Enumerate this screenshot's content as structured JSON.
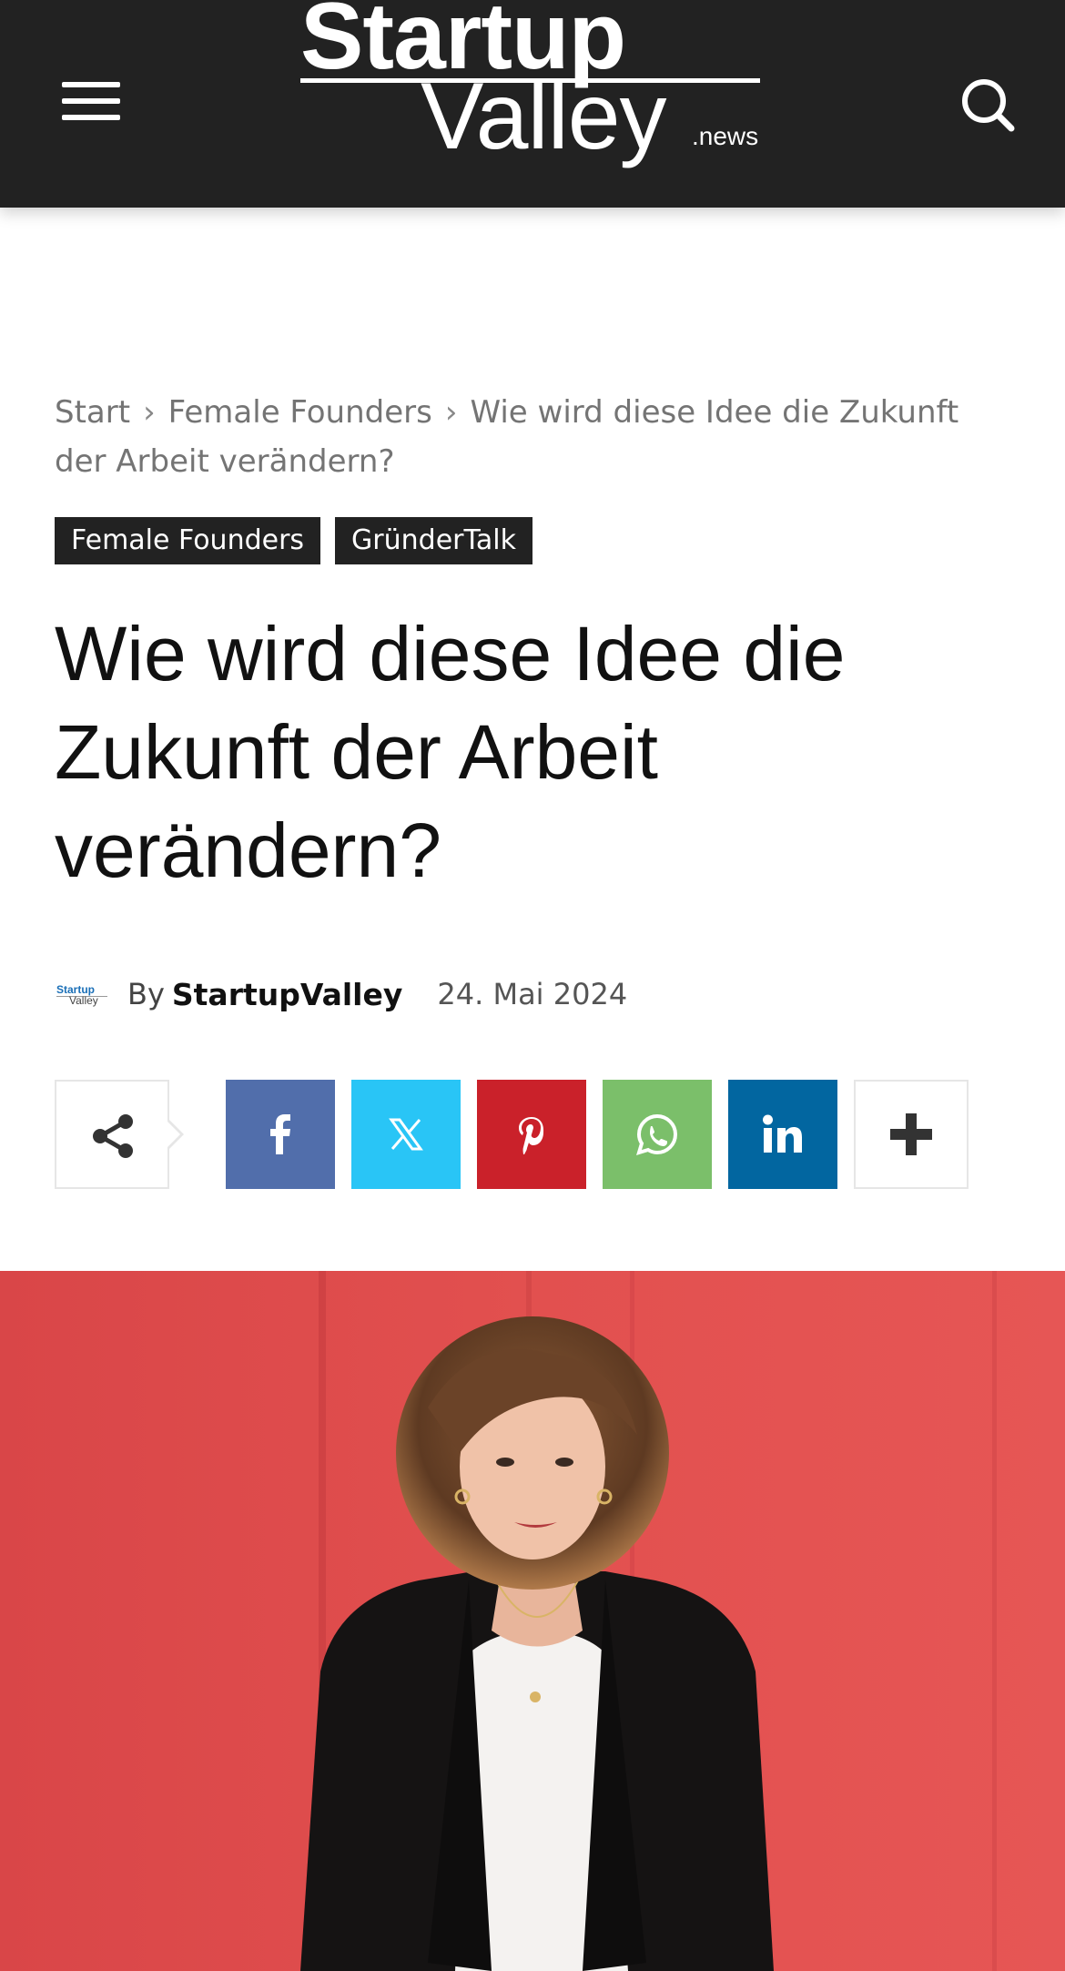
{
  "header": {
    "logo_line1": "Startup",
    "logo_line2": "Valley",
    "logo_suffix": ".news",
    "menu_icon": "hamburger-menu-icon",
    "search_icon": "search-icon",
    "background": "#222222"
  },
  "breadcrumb": {
    "items": [
      "Start",
      "Female Founders",
      "Wie wird diese Idee die Zukunft der Arbeit verändern?"
    ],
    "separator": "›"
  },
  "categories": [
    "Female Founders",
    "GründerTalk"
  ],
  "article": {
    "title": "Wie wird diese Idee die Zukunft der Arbeit verändern?",
    "by_label": "By",
    "author": "StartupValley",
    "date": "24. Mai 2024",
    "avatar_line1": "Startup",
    "avatar_line2": "Valley"
  },
  "share": {
    "buttons": [
      {
        "name": "facebook",
        "icon": "facebook-icon",
        "color": "#516eab"
      },
      {
        "name": "x",
        "icon": "x-twitter-icon",
        "color": "#29c5f6"
      },
      {
        "name": "pinterest",
        "icon": "pinterest-icon",
        "color": "#ca212a"
      },
      {
        "name": "whatsapp",
        "icon": "whatsapp-icon",
        "color": "#7bbf6a"
      },
      {
        "name": "linkedin",
        "icon": "linkedin-icon",
        "color": "#0266a0"
      }
    ],
    "share_icon": "share-icon",
    "more_icon": "plus-icon"
  },
  "hero": {
    "background_color": "#de4d4f"
  }
}
